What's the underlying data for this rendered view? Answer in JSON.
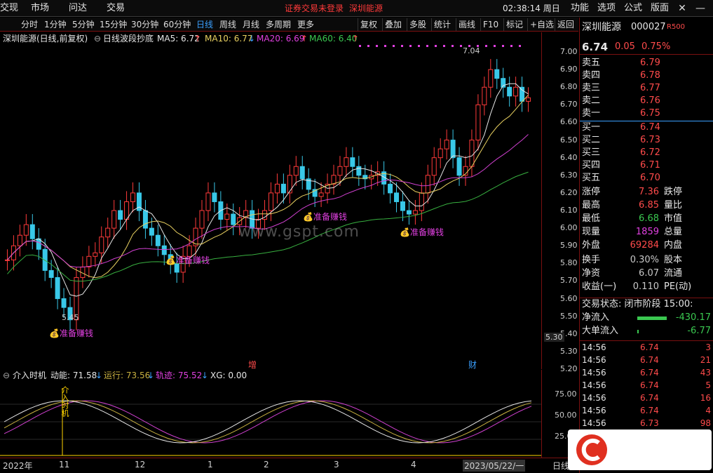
{
  "menu": {
    "item0": "交现",
    "item1": "市场",
    "item2": "问达",
    "item3": "交易",
    "notice": "证券交易未登录",
    "stock_tag": "深圳能源",
    "clock": "02:38:14 周日",
    "func": "功能",
    "options": "选项",
    "formula": "公式",
    "layout": "版面"
  },
  "periods": {
    "p0": "分时",
    "p1": "1分钟",
    "p2": "5分钟",
    "p3": "15分钟",
    "p4": "30分钟",
    "p5": "60分钟",
    "p6": "日线",
    "p7": "周线",
    "p8": "月线",
    "p9": "多周期",
    "p10": "更多"
  },
  "tools": {
    "t0": "复权",
    "t1": "叠加",
    "t2": "多股",
    "t3": "统计",
    "t4": "画线",
    "t5": "F10",
    "t6": "标记",
    "t7": "+自选",
    "t8": "返回"
  },
  "legend": {
    "name": "深圳能源(日线,前复权)",
    "indicator": "日线波段抄底",
    "ma5": "MA5: 6.72",
    "ma5_arrow": "↑",
    "ma10": "MA10: 6.77",
    "ma10_arrow": "↓",
    "ma20": "MA20: 6.69",
    "ma20_arrow": "↑",
    "ma60": "MA60: 6.40",
    "ma60_arrow": "↑"
  },
  "price_axis": {
    "t0": "7.00",
    "t1": "6.90",
    "t2": "6.80",
    "t3": "6.70",
    "t4": "6.60",
    "t5": "6.50",
    "t6": "6.40",
    "t7": "6.30",
    "t8": "6.20",
    "t9": "6.10",
    "t10": "6.00",
    "t11": "5.90",
    "t12": "5.80",
    "t13": "5.70",
    "t14": "5.60",
    "t15": "5.50",
    "t16": "5.40",
    "t17": "5.30",
    "t18": "5.20"
  },
  "annotations": {
    "high": "7.04",
    "low": "5.45",
    "buy_label": "准备赚钱",
    "marker_zeng": "增",
    "marker_cai": "财",
    "watermark": "www.gspt.com"
  },
  "volume_panel": {
    "name": "介入时机",
    "dn": "动能: 71.58",
    "dn_arrow": "↓",
    "yx": "运行: 73.56",
    "yx_arrow": "↓",
    "gj": "轨迹: 75.52",
    "gj_arrow": "↓",
    "xg": "XG: 0.00",
    "signal": "介入时机",
    "ax0": "75.00",
    "ax1": "50.00",
    "ax2": "25.00"
  },
  "x_axis": {
    "l0": "2022年",
    "l1": "11",
    "l2": "12",
    "l3": "1",
    "l4": "2",
    "l5": "3",
    "l6": "4",
    "l7": "2023/05/22/一",
    "l8": "日线"
  },
  "quote": {
    "name": "深圳能源",
    "code": "000027",
    "badge": "R500",
    "price": "6.74",
    "change": "0.05",
    "pct": "0.75%",
    "asks": [
      {
        "label": "卖五",
        "price": "6.79"
      },
      {
        "label": "卖四",
        "price": "6.78"
      },
      {
        "label": "卖三",
        "price": "6.77"
      },
      {
        "label": "卖二",
        "price": "6.76"
      },
      {
        "label": "卖一",
        "price": "6.75"
      }
    ],
    "bids": [
      {
        "label": "买一",
        "price": "6.74"
      },
      {
        "label": "买二",
        "price": "6.73"
      },
      {
        "label": "买三",
        "price": "6.72"
      },
      {
        "label": "买四",
        "price": "6.71"
      },
      {
        "label": "买五",
        "price": "6.70"
      }
    ],
    "stats": [
      {
        "a": "涨停",
        "b": "7.36",
        "c": "跌停"
      },
      {
        "a": "最高",
        "b": "6.85",
        "c": "量比"
      },
      {
        "a": "最低",
        "b": "6.68",
        "c": "市值"
      },
      {
        "a": "现量",
        "b": "1859",
        "c": "总量"
      },
      {
        "a": "外盘",
        "b": "69284",
        "c": "内盘"
      },
      {
        "a": "换手",
        "b": "0.30%",
        "c": "股本"
      },
      {
        "a": "净资",
        "b": "6.07",
        "c": "流通"
      },
      {
        "a": "收益(一)",
        "b": "0.110",
        "c": "PE(动)"
      }
    ],
    "status": "交易状态: 闭市阶段 15:00:",
    "netflow_label": "净流入",
    "netflow": "-430.17",
    "bigflow_label": "大单流入",
    "bigflow": "-6.77",
    "ticks": [
      {
        "t": "14:56",
        "p": "6.74",
        "v": "3"
      },
      {
        "t": "14:56",
        "p": "6.74",
        "v": "21"
      },
      {
        "t": "14:56",
        "p": "6.74",
        "v": "43"
      },
      {
        "t": "14:56",
        "p": "6.74",
        "v": "5"
      },
      {
        "t": "14:56",
        "p": "6.74",
        "v": "16"
      },
      {
        "t": "14:56",
        "p": "6.74",
        "v": "4"
      },
      {
        "t": "14:56",
        "p": "6.73",
        "v": "98"
      }
    ]
  },
  "chart_data": {
    "type": "candlestick",
    "ohlc_close": [
      5.82,
      5.9,
      5.96,
      6.02,
      5.94,
      5.88,
      5.76,
      5.72,
      5.6,
      5.55,
      5.48,
      5.72,
      5.78,
      5.84,
      5.86,
      5.95,
      6.0,
      6.1,
      6.05,
      6.15,
      6.2,
      6.1,
      6.0,
      5.96,
      5.9,
      5.85,
      5.8,
      5.75,
      5.84,
      5.9,
      6.0,
      6.1,
      6.2,
      6.15,
      6.05,
      6.08,
      6.02,
      6.06,
      6.1,
      6.0,
      6.05,
      6.1,
      6.2,
      6.25,
      6.2,
      6.3,
      6.35,
      6.28,
      6.22,
      6.18,
      6.2,
      6.25,
      6.3,
      6.35,
      6.4,
      6.35,
      6.3,
      6.28,
      6.3,
      6.32,
      6.25,
      6.2,
      6.15,
      6.1,
      6.08,
      6.1,
      6.2,
      6.3,
      6.4,
      6.45,
      6.5,
      6.4,
      6.3,
      6.35,
      6.5,
      6.7,
      6.8,
      6.9,
      6.85,
      6.8,
      6.75,
      6.8,
      6.72,
      6.74
    ],
    "ma60_end": 6.4,
    "high": 7.04,
    "low": 5.45,
    "ylim": [
      5.2,
      7.04
    ],
    "indicator": {
      "dn": 71.58,
      "yx": 73.56,
      "gj": 75.52,
      "xg": 0.0,
      "ylim": [
        0,
        100
      ]
    }
  }
}
